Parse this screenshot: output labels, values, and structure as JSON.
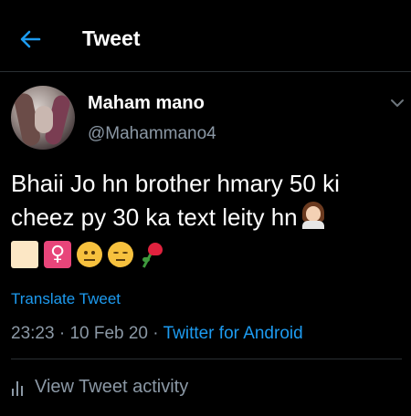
{
  "header": {
    "title": "Tweet",
    "back_icon": "arrow-left-icon"
  },
  "author": {
    "display_name": "Maham mano",
    "handle": "@Mahammano4"
  },
  "tweet": {
    "text": "Bhaii Jo hn brother hmary 50 ki cheez py 30 ka text leity hn",
    "trailing_emoji": "woman-technologist-emoji",
    "emoji_row": [
      "white-square-emoji",
      "female-sign-emoji",
      "neutral-face-emoji",
      "unamused-face-emoji",
      "rose-emoji"
    ]
  },
  "translate_label": "Translate Tweet",
  "meta": {
    "time": "23:23",
    "separator1": " · ",
    "date": "10 Feb 20",
    "separator2": " · ",
    "source": "Twitter for Android"
  },
  "activity_label": "View Tweet activity",
  "colors": {
    "accent": "#1d9bf0",
    "background": "#000000",
    "secondary_text": "#8b98a5"
  }
}
